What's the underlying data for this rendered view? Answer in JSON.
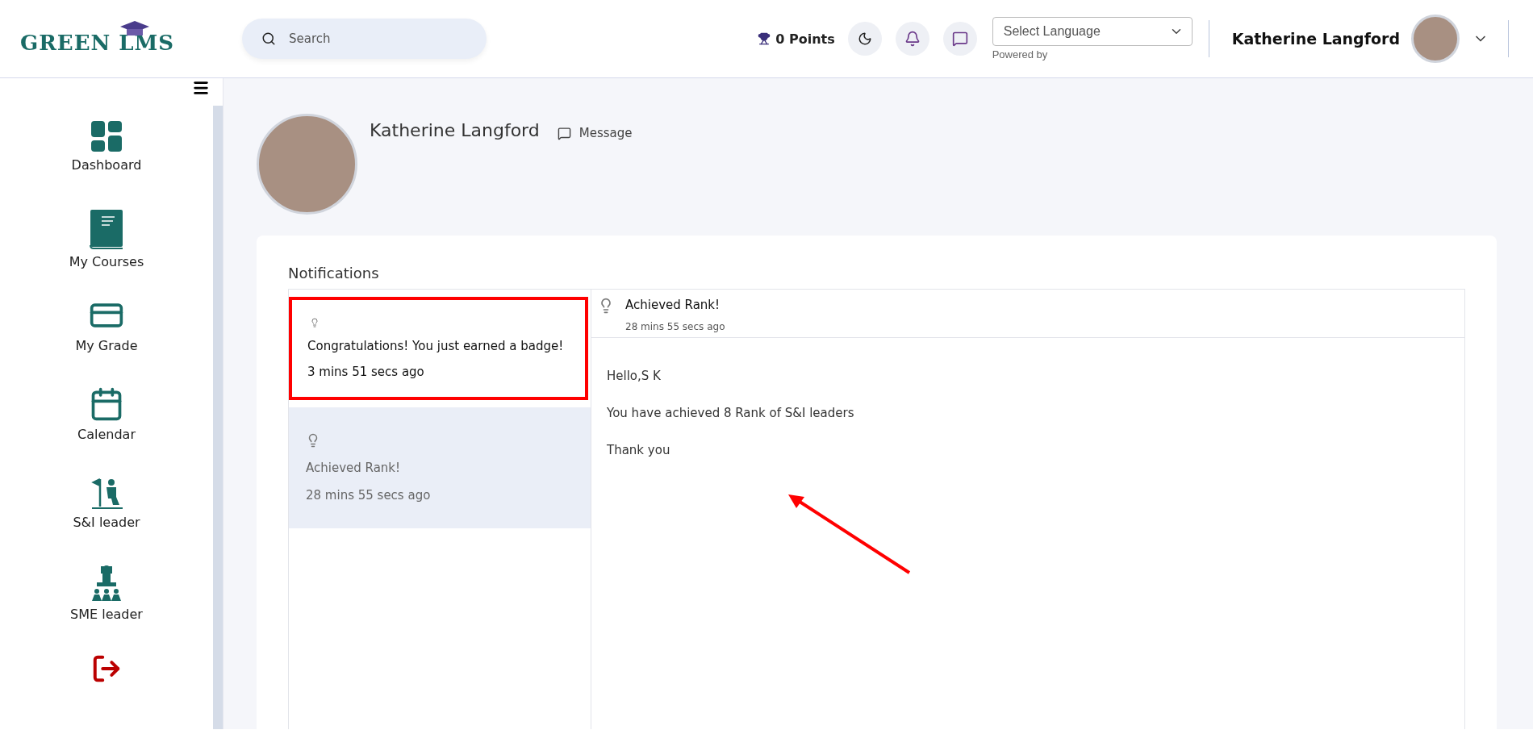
{
  "header": {
    "logo": "GREEN LMS",
    "search": {
      "placeholder": "Search"
    },
    "points": "0 Points",
    "language": {
      "value": "Select Language",
      "note": "Powered by"
    },
    "user": "Katherine Langford"
  },
  "sidebar": {
    "items": [
      {
        "label": "Dashboard",
        "kind": "dashboard"
      },
      {
        "label": "My Courses",
        "kind": "courses"
      },
      {
        "label": "My Grade",
        "kind": "grade"
      },
      {
        "label": "Calendar",
        "kind": "calendar"
      },
      {
        "label": "S&I leader",
        "kind": "si"
      },
      {
        "label": "SME leader",
        "kind": "sme"
      },
      {
        "kind": "logout"
      }
    ]
  },
  "profile": {
    "name": "Katherine Langford",
    "message": "Message"
  },
  "notifications": {
    "title": "Notifications",
    "items": [
      {
        "text": "Congratulations! You just earned a badge!",
        "time": "3 mins 51 secs ago",
        "selected": false,
        "annotated": true
      },
      {
        "text": "Achieved Rank!",
        "time": "28 mins 55 secs ago",
        "selected": true,
        "annotated": false
      }
    ],
    "detail": {
      "title": "Achieved Rank!",
      "time": "28 mins 55 secs ago",
      "lines": [
        "Hello,S K",
        "You have achieved 8 Rank of S&I leaders",
        "Thank you"
      ]
    }
  }
}
